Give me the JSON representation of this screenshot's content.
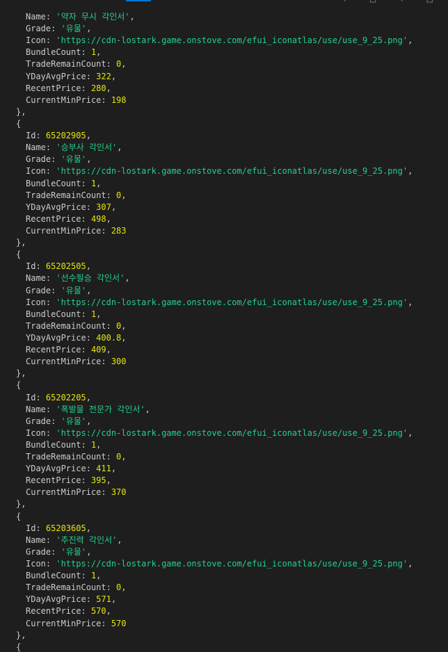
{
  "ui": {
    "corner_glyphs": "‹ □ ‹ □",
    "colors": {
      "background": "#1e1e1e",
      "key": "#cccccc",
      "number": "#e5e510",
      "string": "#23d18b",
      "accent": "#0078d4"
    }
  },
  "lines": [
    {
      "t": "field",
      "key": "Name",
      "kind": "str",
      "val": "'약자 무시 각인서'"
    },
    {
      "t": "field",
      "key": "Grade",
      "kind": "str",
      "val": "'유물'"
    },
    {
      "t": "field",
      "key": "Icon",
      "kind": "str",
      "val": "'https://cdn-lostark.game.onstove.com/efui_iconatlas/use/use_9_25.png'"
    },
    {
      "t": "field",
      "key": "BundleCount",
      "kind": "num",
      "val": "1"
    },
    {
      "t": "field",
      "key": "TradeRemainCount",
      "kind": "num",
      "val": "0"
    },
    {
      "t": "field",
      "key": "YDayAvgPrice",
      "kind": "num",
      "val": "322"
    },
    {
      "t": "field",
      "key": "RecentPrice",
      "kind": "num",
      "val": "280"
    },
    {
      "t": "field",
      "key": "CurrentMinPrice",
      "kind": "num",
      "val": "198",
      "last": true
    },
    {
      "t": "close",
      "text": "},"
    },
    {
      "t": "open",
      "text": "{"
    },
    {
      "t": "field",
      "key": "Id",
      "kind": "num",
      "val": "65202905"
    },
    {
      "t": "field",
      "key": "Name",
      "kind": "str",
      "val": "'승부사 각인서'"
    },
    {
      "t": "field",
      "key": "Grade",
      "kind": "str",
      "val": "'유물'"
    },
    {
      "t": "field",
      "key": "Icon",
      "kind": "str",
      "val": "'https://cdn-lostark.game.onstove.com/efui_iconatlas/use/use_9_25.png'"
    },
    {
      "t": "field",
      "key": "BundleCount",
      "kind": "num",
      "val": "1"
    },
    {
      "t": "field",
      "key": "TradeRemainCount",
      "kind": "num",
      "val": "0"
    },
    {
      "t": "field",
      "key": "YDayAvgPrice",
      "kind": "num",
      "val": "307"
    },
    {
      "t": "field",
      "key": "RecentPrice",
      "kind": "num",
      "val": "498"
    },
    {
      "t": "field",
      "key": "CurrentMinPrice",
      "kind": "num",
      "val": "283",
      "last": true
    },
    {
      "t": "close",
      "text": "},"
    },
    {
      "t": "open",
      "text": "{"
    },
    {
      "t": "field",
      "key": "Id",
      "kind": "num",
      "val": "65202505"
    },
    {
      "t": "field",
      "key": "Name",
      "kind": "str",
      "val": "'선수필승 각인서'"
    },
    {
      "t": "field",
      "key": "Grade",
      "kind": "str",
      "val": "'유물'"
    },
    {
      "t": "field",
      "key": "Icon",
      "kind": "str",
      "val": "'https://cdn-lostark.game.onstove.com/efui_iconatlas/use/use_9_25.png'"
    },
    {
      "t": "field",
      "key": "BundleCount",
      "kind": "num",
      "val": "1"
    },
    {
      "t": "field",
      "key": "TradeRemainCount",
      "kind": "num",
      "val": "0"
    },
    {
      "t": "field",
      "key": "YDayAvgPrice",
      "kind": "num",
      "val": "400.8"
    },
    {
      "t": "field",
      "key": "RecentPrice",
      "kind": "num",
      "val": "409"
    },
    {
      "t": "field",
      "key": "CurrentMinPrice",
      "kind": "num",
      "val": "300",
      "last": true
    },
    {
      "t": "close",
      "text": "},"
    },
    {
      "t": "open",
      "text": "{"
    },
    {
      "t": "field",
      "key": "Id",
      "kind": "num",
      "val": "65202205"
    },
    {
      "t": "field",
      "key": "Name",
      "kind": "str",
      "val": "'폭발물 전문가 각인서'"
    },
    {
      "t": "field",
      "key": "Grade",
      "kind": "str",
      "val": "'유물'"
    },
    {
      "t": "field",
      "key": "Icon",
      "kind": "str",
      "val": "'https://cdn-lostark.game.onstove.com/efui_iconatlas/use/use_9_25.png'"
    },
    {
      "t": "field",
      "key": "BundleCount",
      "kind": "num",
      "val": "1"
    },
    {
      "t": "field",
      "key": "TradeRemainCount",
      "kind": "num",
      "val": "0"
    },
    {
      "t": "field",
      "key": "YDayAvgPrice",
      "kind": "num",
      "val": "411"
    },
    {
      "t": "field",
      "key": "RecentPrice",
      "kind": "num",
      "val": "395"
    },
    {
      "t": "field",
      "key": "CurrentMinPrice",
      "kind": "num",
      "val": "370",
      "last": true
    },
    {
      "t": "close",
      "text": "},"
    },
    {
      "t": "open",
      "text": "{"
    },
    {
      "t": "field",
      "key": "Id",
      "kind": "num",
      "val": "65203605"
    },
    {
      "t": "field",
      "key": "Name",
      "kind": "str",
      "val": "'추진력 각인서'"
    },
    {
      "t": "field",
      "key": "Grade",
      "kind": "str",
      "val": "'유물'"
    },
    {
      "t": "field",
      "key": "Icon",
      "kind": "str",
      "val": "'https://cdn-lostark.game.onstove.com/efui_iconatlas/use/use_9_25.png'"
    },
    {
      "t": "field",
      "key": "BundleCount",
      "kind": "num",
      "val": "1"
    },
    {
      "t": "field",
      "key": "TradeRemainCount",
      "kind": "num",
      "val": "0"
    },
    {
      "t": "field",
      "key": "YDayAvgPrice",
      "kind": "num",
      "val": "571"
    },
    {
      "t": "field",
      "key": "RecentPrice",
      "kind": "num",
      "val": "570"
    },
    {
      "t": "field",
      "key": "CurrentMinPrice",
      "kind": "num",
      "val": "570",
      "last": true
    },
    {
      "t": "close",
      "text": "},"
    },
    {
      "t": "open",
      "text": "{"
    }
  ]
}
